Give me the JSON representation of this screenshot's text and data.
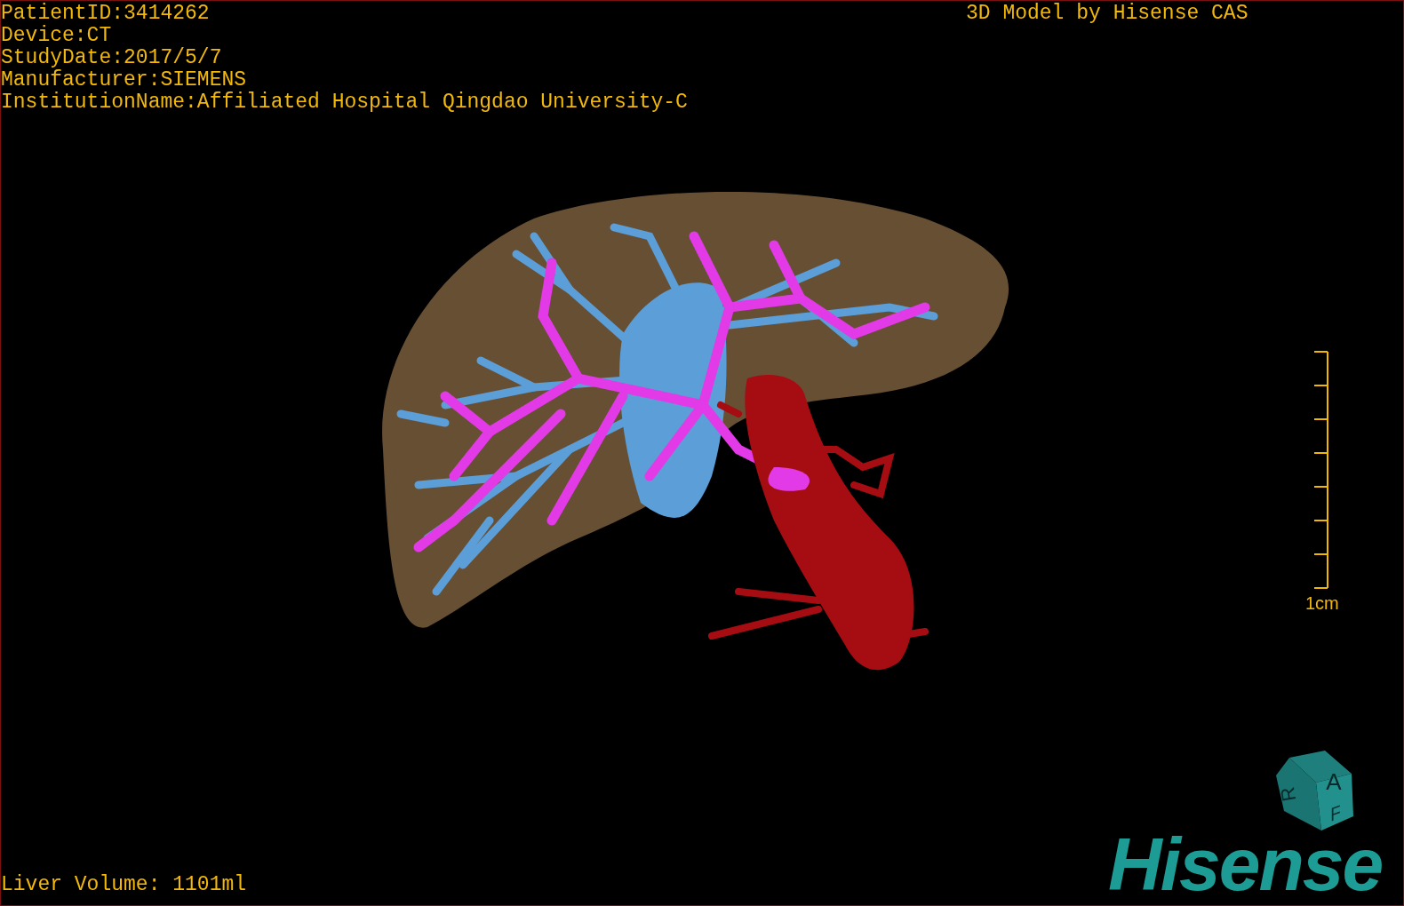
{
  "info_lines": [
    "PatientID:3414262",
    "Device:CT",
    "StudyDate:2017/5/7",
    "Manufacturer:SIEMENS",
    "InstitutionName:Affiliated Hospital Qingdao University-C"
  ],
  "title_label": "3D Model by Hisense CAS",
  "scale_bar": {
    "label": "1cm"
  },
  "orientation_cube": {
    "faces": [
      "A",
      "R",
      "F"
    ]
  },
  "logo": {
    "text": "Hisense"
  },
  "liver_volume": "Liver Volume: 1101ml"
}
